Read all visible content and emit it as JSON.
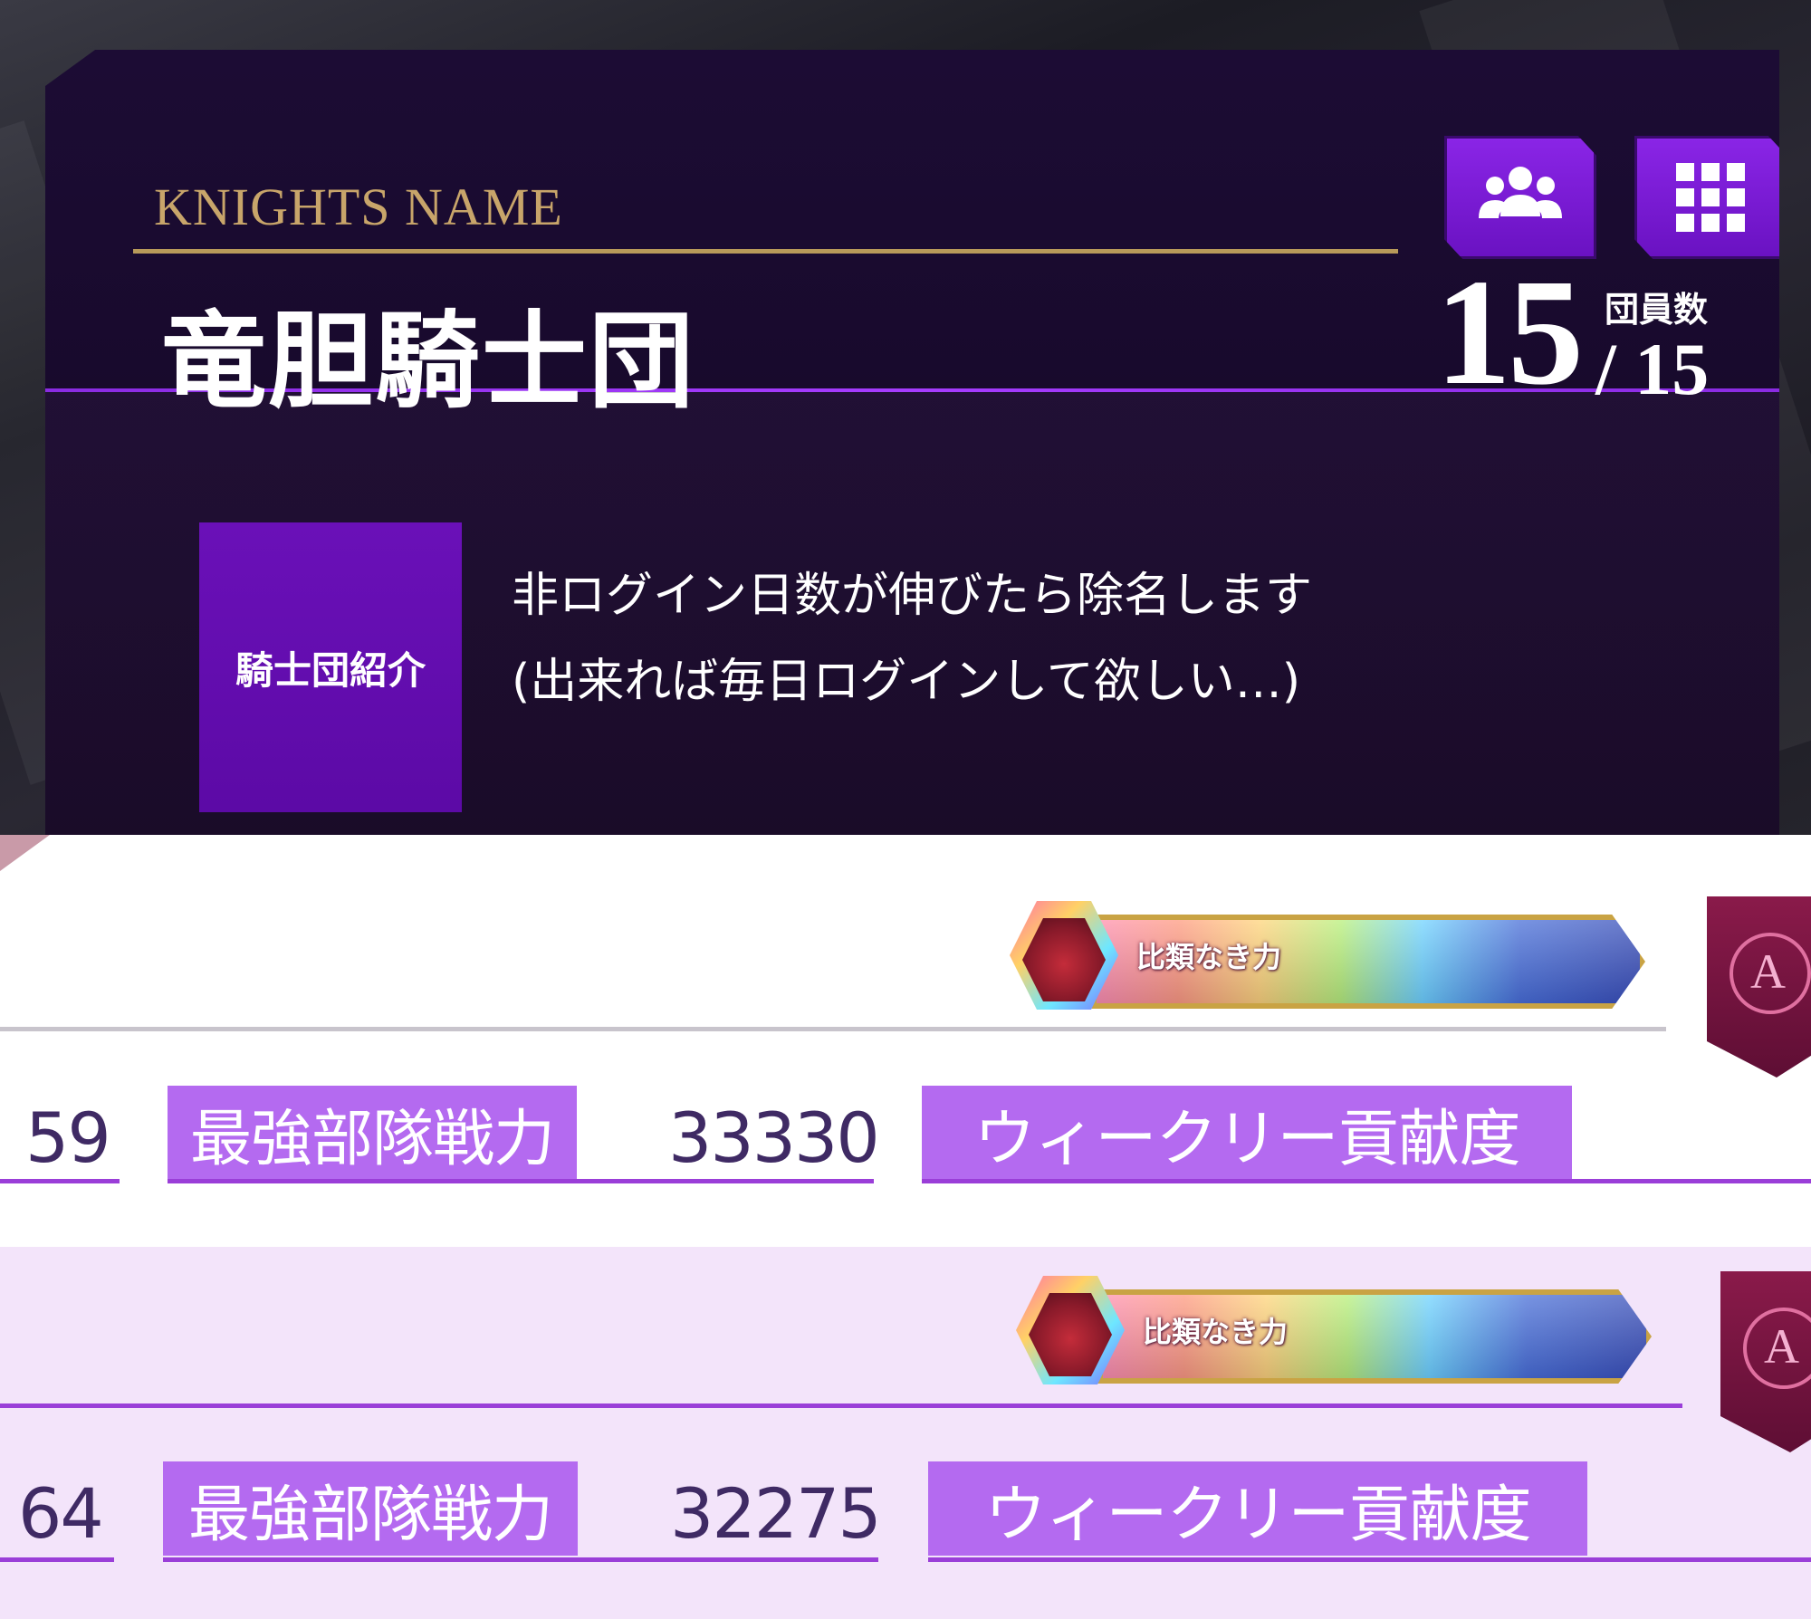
{
  "header": {
    "section_label": "KNIGHTS NAME",
    "knights_name": "竜胆騎士団",
    "member_count": "15",
    "member_count_label": "団員数",
    "member_max": "/ 15"
  },
  "buttons": {
    "members_icon": "members-icon",
    "grid_icon": "grid-menu-icon"
  },
  "intro": {
    "label": "騎士団紹介",
    "line1": "非ログイン日数が伸びたら除名します",
    "line2": "(出来れば毎日ログインして欲しい…)"
  },
  "members": [
    {
      "title_badge": "比類なき力",
      "rank_emblem": "A",
      "left_value": "59",
      "power_label": "最強部隊戦力",
      "power_value": "33330",
      "weekly_label": "ウィークリー貢献度"
    },
    {
      "title_badge": "比類なき力",
      "rank_emblem": "A",
      "left_value": "64",
      "power_label": "最強部隊戦力",
      "power_value": "32275",
      "weekly_label": "ウィークリー貢献度"
    }
  ],
  "colors": {
    "card_bg": "#180a2c",
    "accent_purple": "#8a2be2",
    "gold": "#c8a56a",
    "tag_purple": "#b46af0",
    "row_alt_bg": "#f3e4fa"
  }
}
